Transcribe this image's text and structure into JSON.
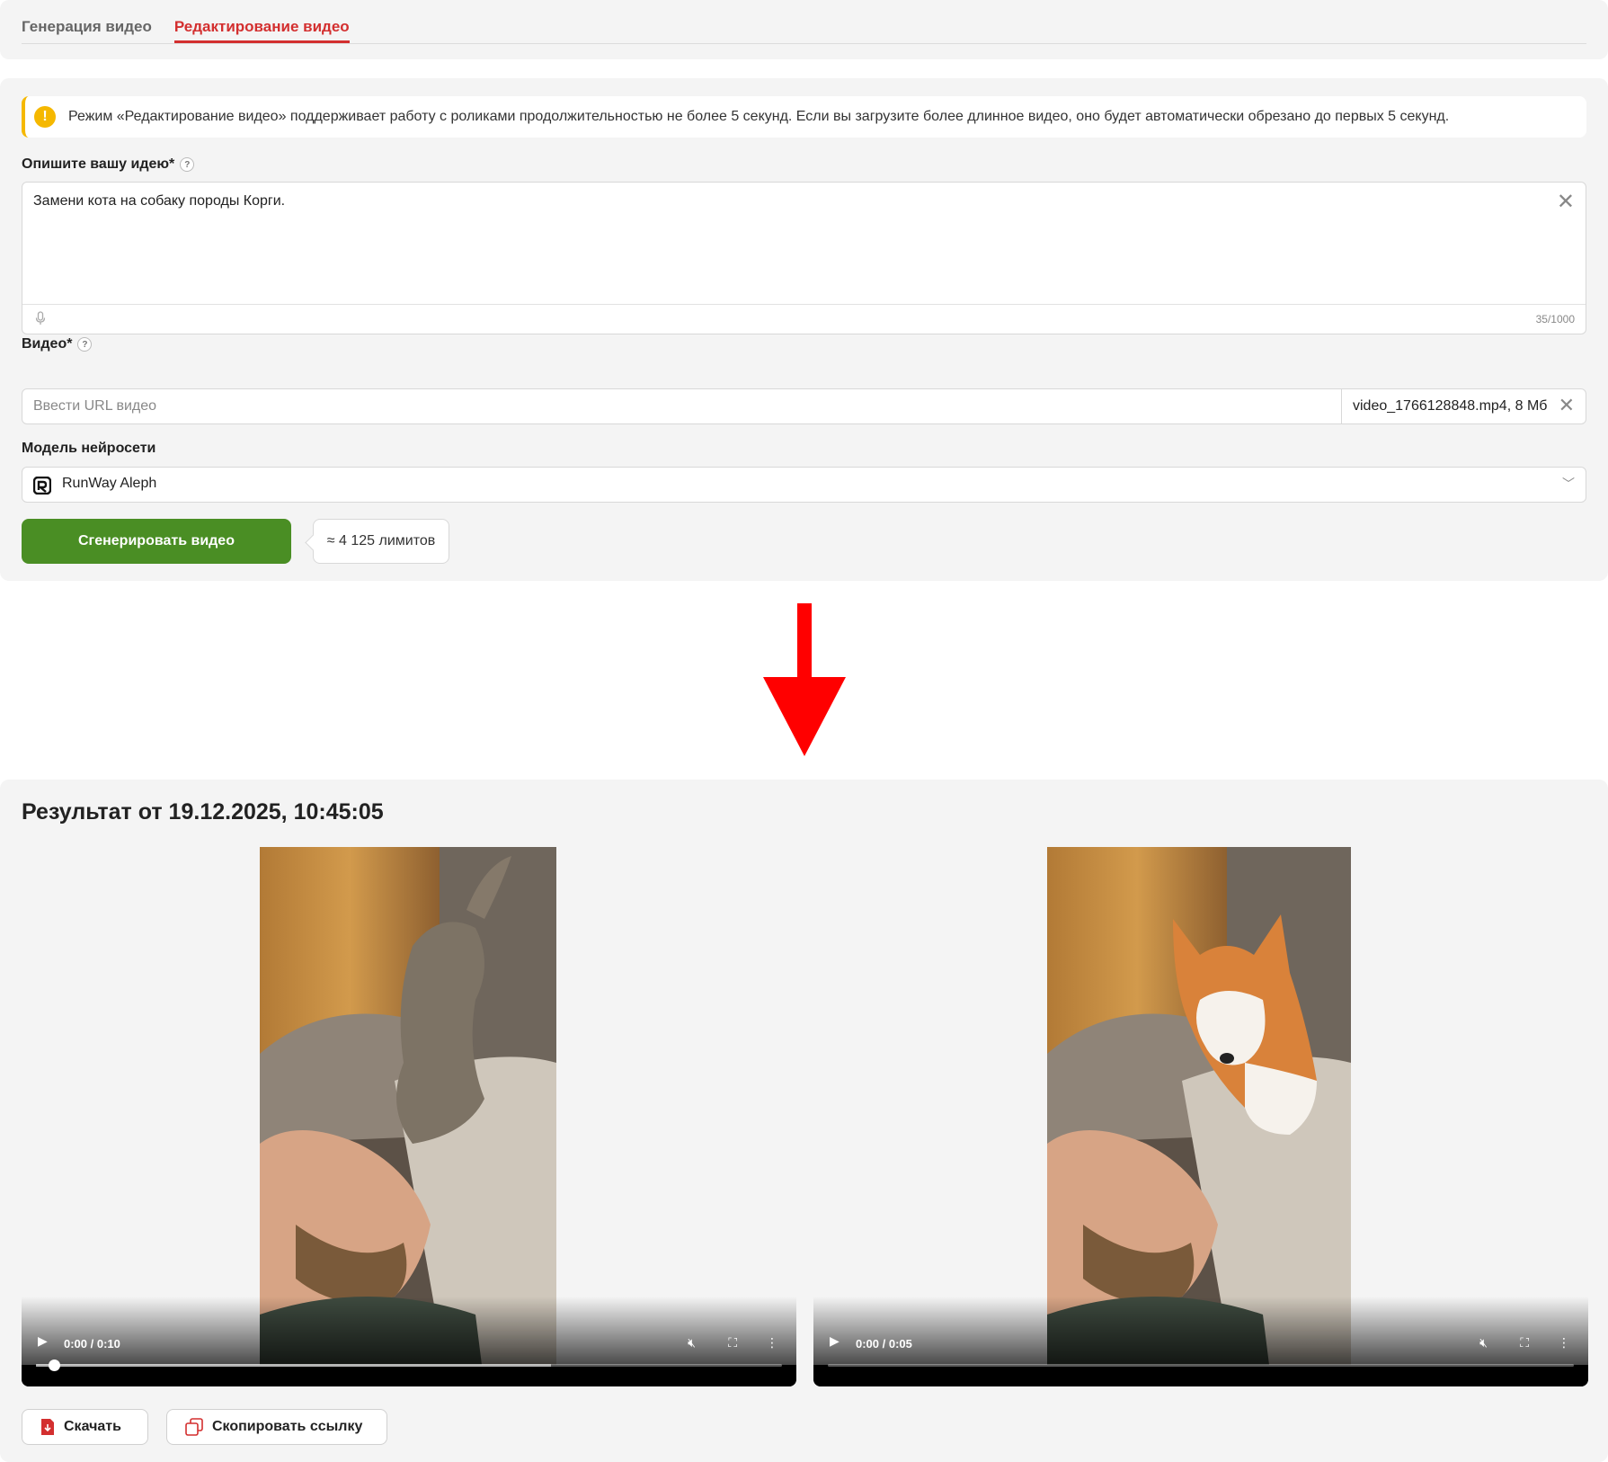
{
  "tabs": [
    {
      "label": "Генерация видео",
      "active": false
    },
    {
      "label": "Редактирование видео",
      "active": true
    }
  ],
  "notice": {
    "icon": "warning-icon",
    "text": "Режим «Редактирование видео» поддерживает работу с роликами продолжительностью не более 5 секунд. Если вы загрузите более длинное видео, оно будет автоматически обрезано до первых 5 секунд."
  },
  "idea": {
    "label": "Опишите вашу идею*",
    "value": "Замени кота на собаку породы Корги.",
    "counter": "35/1000"
  },
  "video": {
    "label": "Видео*",
    "url_placeholder": "Ввести URL видео",
    "file_name": "video_1766128848.mp4, 8 Мб"
  },
  "model": {
    "label": "Модель нейросети",
    "selected": "RunWay Aleph"
  },
  "generate": {
    "button_label": "Сгенерировать видео",
    "limits": "≈ 4 125 лимитов"
  },
  "result": {
    "title": "Результат от 19.12.2025, 10:45:05",
    "players": [
      {
        "time": "0:00 / 0:10",
        "muted": true
      },
      {
        "time": "0:00 / 0:05",
        "muted": true
      }
    ],
    "download_label": "Скачать",
    "copy_link_label": "Скопировать ссылку"
  },
  "colors": {
    "accent": "#d32f2f",
    "primary_button": "#4a8e24",
    "warning": "#f5b800",
    "arrow": "#ff0000"
  }
}
